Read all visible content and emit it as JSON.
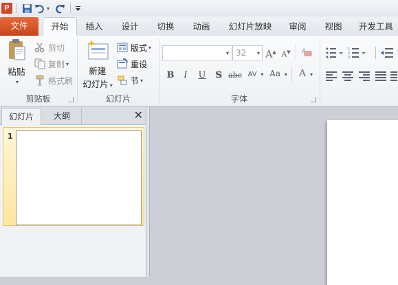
{
  "app": {
    "logo_letter": "P"
  },
  "quick_access": {
    "items": [
      "save-icon",
      "undo-icon",
      "redo-icon",
      "customize-icon"
    ]
  },
  "tabs": [
    {
      "label": "文件"
    },
    {
      "label": "开始"
    },
    {
      "label": "插入"
    },
    {
      "label": "设计"
    },
    {
      "label": "切换"
    },
    {
      "label": "动画"
    },
    {
      "label": "幻灯片放映"
    },
    {
      "label": "审阅"
    },
    {
      "label": "视图"
    },
    {
      "label": "开发工具"
    }
  ],
  "clipboard": {
    "label": "剪贴板",
    "paste": "粘贴",
    "cut": "剪切",
    "copy": "复制",
    "format_painter": "格式刷"
  },
  "slides_group": {
    "label": "幻灯片",
    "new_slide_line1": "新建",
    "new_slide_line2": "幻灯片",
    "layout": "版式",
    "reset": "重设",
    "section": "节"
  },
  "font_group": {
    "label": "字体",
    "font_name": "",
    "font_size": "32",
    "bold": "B",
    "italic": "I",
    "underline": "U",
    "shadow": "S",
    "strikethrough": "abc",
    "spacing": "AV",
    "change_case": "Aa",
    "font_color": "A"
  },
  "pane": {
    "tab_slides": "幻灯片",
    "tab_outline": "大纲",
    "close": "✕",
    "slides": [
      {
        "number": "1"
      }
    ]
  },
  "colors": {
    "file_tab": "#d24726",
    "selected_slide": "#ffe6a0"
  }
}
